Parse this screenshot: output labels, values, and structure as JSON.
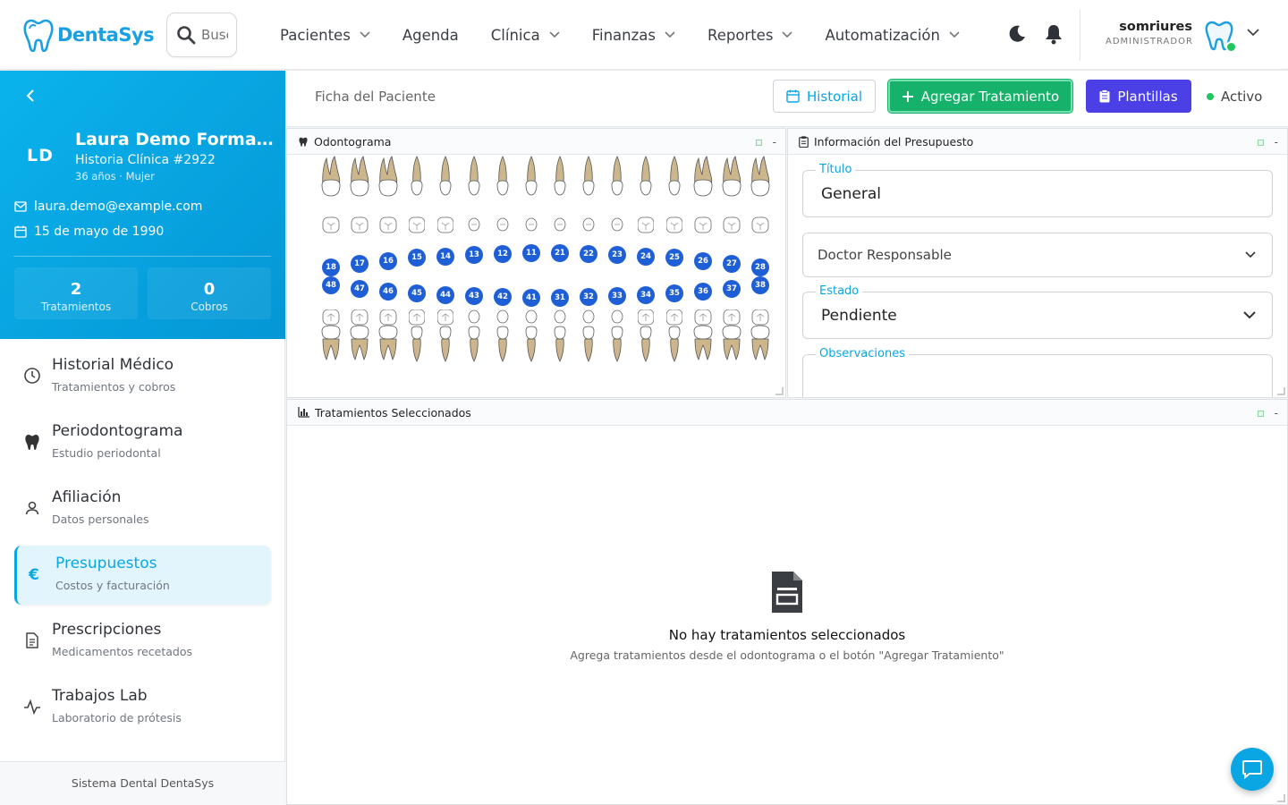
{
  "app": {
    "name": "DentaSys"
  },
  "search": {
    "placeholder": "Buscar..."
  },
  "nav": [
    {
      "label": "Pacientes",
      "dropdown": true
    },
    {
      "label": "Agenda",
      "dropdown": false
    },
    {
      "label": "Clínica",
      "dropdown": true
    },
    {
      "label": "Finanzas",
      "dropdown": true
    },
    {
      "label": "Reportes",
      "dropdown": true
    },
    {
      "label": "Automatización",
      "dropdown": true
    }
  ],
  "top_icons": [
    "moon-icon",
    "bell-icon"
  ],
  "user": {
    "name": "somriures",
    "role": "ADMINISTRADOR",
    "status": "online"
  },
  "patient": {
    "initials": "LD",
    "name": "Laura Demo Forma...",
    "history": "Historia Clínica #2922",
    "meta": "36 años · Mujer",
    "email": "laura.demo@example.com",
    "birthdate": "15 de mayo de 1990",
    "stats": [
      {
        "value": "2",
        "label": "Tratamientos"
      },
      {
        "value": "0",
        "label": "Cobros"
      }
    ]
  },
  "sidebar": {
    "items": [
      {
        "title": "Historial Médico",
        "subtitle": "Tratamientos y cobros",
        "icon": "clock-icon",
        "active": false
      },
      {
        "title": "Periodontograma",
        "subtitle": "Estudio periodontal",
        "icon": "tooth-icon",
        "active": false
      },
      {
        "title": "Afiliación",
        "subtitle": "Datos personales",
        "icon": "user-icon",
        "active": false
      },
      {
        "title": "Presupuestos",
        "subtitle": "Costos y facturación",
        "icon": "euro-icon",
        "active": true
      },
      {
        "title": "Prescripciones",
        "subtitle": "Medicamentos recetados",
        "icon": "document-icon",
        "active": false
      },
      {
        "title": "Trabajos Lab",
        "subtitle": "Laboratorio de prótesis",
        "icon": "activity-icon",
        "active": false
      }
    ],
    "footer": "Sistema Dental DentaSys"
  },
  "header": {
    "title": "Ficha del Paciente",
    "history_button": "Historial",
    "add_button": "Agregar Tratamiento",
    "templates_button": "Plantillas",
    "status": "Activo"
  },
  "odontogram": {
    "title": "Odontograma",
    "upper": [
      "18",
      "17",
      "16",
      "15",
      "14",
      "13",
      "12",
      "11",
      "21",
      "22",
      "23",
      "24",
      "25",
      "26",
      "27",
      "28"
    ],
    "lower": [
      "48",
      "47",
      "46",
      "45",
      "44",
      "43",
      "42",
      "41",
      "31",
      "32",
      "33",
      "34",
      "35",
      "36",
      "37",
      "38"
    ]
  },
  "budget": {
    "title": "Información del Presupuesto",
    "title_label": "Título",
    "title_value": "General",
    "doctor_placeholder": "Doctor Responsable",
    "status_label": "Estado",
    "status_value": "Pendiente",
    "notes_label": "Observaciones"
  },
  "treatments": {
    "title": "Tratamientos Seleccionados",
    "empty_title": "No hay tratamientos seleccionados",
    "empty_subtitle": "Agrega tratamientos desde el odontograma o el botón \"Agregar Tratamiento\""
  },
  "colors": {
    "brand": "#0aa6e4",
    "add": "#16b26b",
    "templates": "#4b3fe6",
    "tooth_badge": "#1f5fd6",
    "root": "#cdb58c"
  }
}
